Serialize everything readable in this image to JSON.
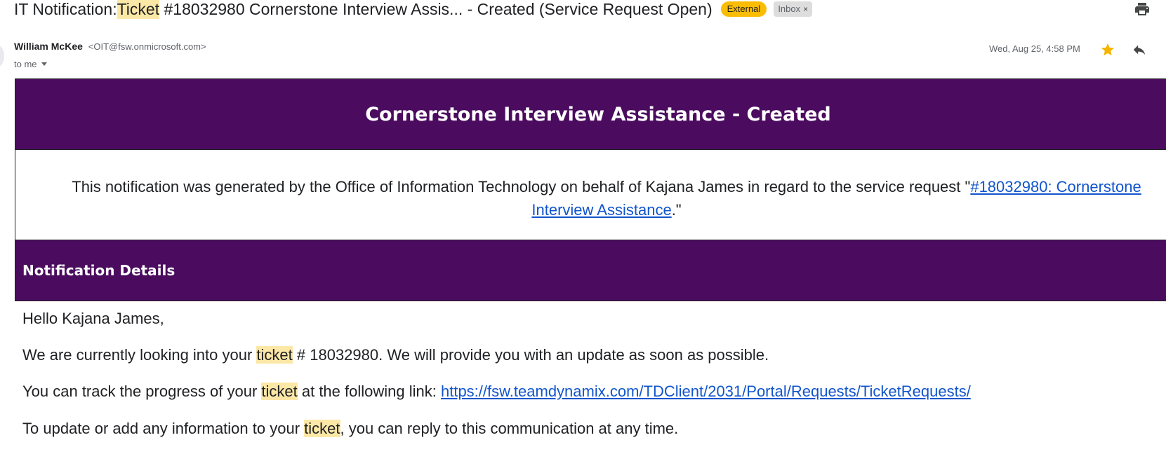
{
  "subject": {
    "prefix": "IT Notification: ",
    "highlight": "Ticket",
    "suffix": " #18032980 Cornerstone Interview Assis... - Created (Service Request Open)"
  },
  "labels": {
    "external": "External",
    "inbox": "Inbox",
    "inbox_close": "×"
  },
  "sender": {
    "name": "William McKee",
    "email": "<OIT@fsw.onmicrosoft.com>",
    "to": "to me"
  },
  "date": "Wed, Aug 25, 4:58 PM",
  "icons": {
    "print": "print-icon",
    "star": "star-icon",
    "reply": "reply-icon",
    "caret": "chevron-down-icon"
  },
  "colors": {
    "banner": "#4b0c5f",
    "external_badge": "#fbbc04",
    "star": "#f4b400",
    "link": "#1155cc",
    "highlight": "#fce8a6"
  },
  "email": {
    "banner_title": "Cornerstone Interview Assistance - Created",
    "notice_text": "This notification was generated by the Office of Information Technology on behalf of Kajana James in regard to the service request \"",
    "notice_link": "#18032980: Cornerstone Interview Assistance",
    "notice_end": ".\"",
    "details_title": "Notification Details",
    "greeting": "Hello Kajana James,",
    "line1_a": "We are currently looking into your ",
    "line1_hl": "ticket",
    "line1_b": " # 18032980. We will provide you with an update as soon as possible.",
    "line2_a": "You can track the progress of your ",
    "line2_hl": "ticket",
    "line2_b": " at the following link: ",
    "line2_link": "https://fsw.teamdynamix.com/TDClient/2031/Portal/Requests/TicketRequests/",
    "line3_a": "To update or add any information to your ",
    "line3_hl": "ticket",
    "line3_b": ", you can reply to this communication at any time."
  }
}
